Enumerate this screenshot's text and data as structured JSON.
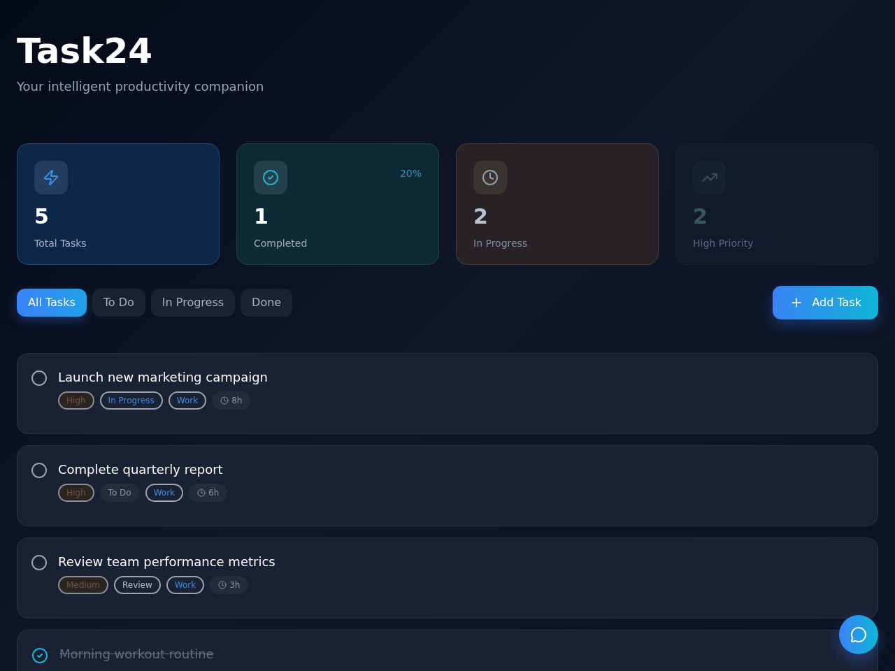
{
  "header": {
    "title": "Task24",
    "subtitle": "Your intelligent productivity companion"
  },
  "stats": [
    {
      "kind": "total",
      "value": "5",
      "label": "Total Tasks"
    },
    {
      "kind": "completed",
      "value": "1",
      "label": "Completed",
      "badge": "20%"
    },
    {
      "kind": "progress",
      "value": "2",
      "label": "In Progress"
    },
    {
      "kind": "priority",
      "value": "2",
      "label": "High Priority"
    }
  ],
  "filters": [
    {
      "label": "All Tasks",
      "selected": true
    },
    {
      "label": "To Do",
      "selected": false
    },
    {
      "label": "In Progress",
      "selected": false
    },
    {
      "label": "Done",
      "selected": false
    }
  ],
  "add_button": "Add Task",
  "tasks": [
    {
      "title": "Launch new marketing campaign",
      "completed": false,
      "tags": [
        {
          "kind": "priority",
          "label": "High"
        },
        {
          "kind": "status-outline",
          "label": "In Progress"
        },
        {
          "kind": "category",
          "label": "Work"
        },
        {
          "kind": "time",
          "label": "8h"
        }
      ]
    },
    {
      "title": "Complete quarterly report",
      "completed": false,
      "tags": [
        {
          "kind": "priority",
          "label": "High"
        },
        {
          "kind": "status-plain",
          "label": "To Do"
        },
        {
          "kind": "category",
          "label": "Work"
        },
        {
          "kind": "time",
          "label": "6h"
        }
      ]
    },
    {
      "title": "Review team performance metrics",
      "completed": false,
      "tags": [
        {
          "kind": "priority",
          "label": "Medium"
        },
        {
          "kind": "status-gray",
          "label": "Review"
        },
        {
          "kind": "category",
          "label": "Work"
        },
        {
          "kind": "time",
          "label": "3h"
        }
      ]
    },
    {
      "title": "Morning workout routine",
      "completed": true
    }
  ]
}
